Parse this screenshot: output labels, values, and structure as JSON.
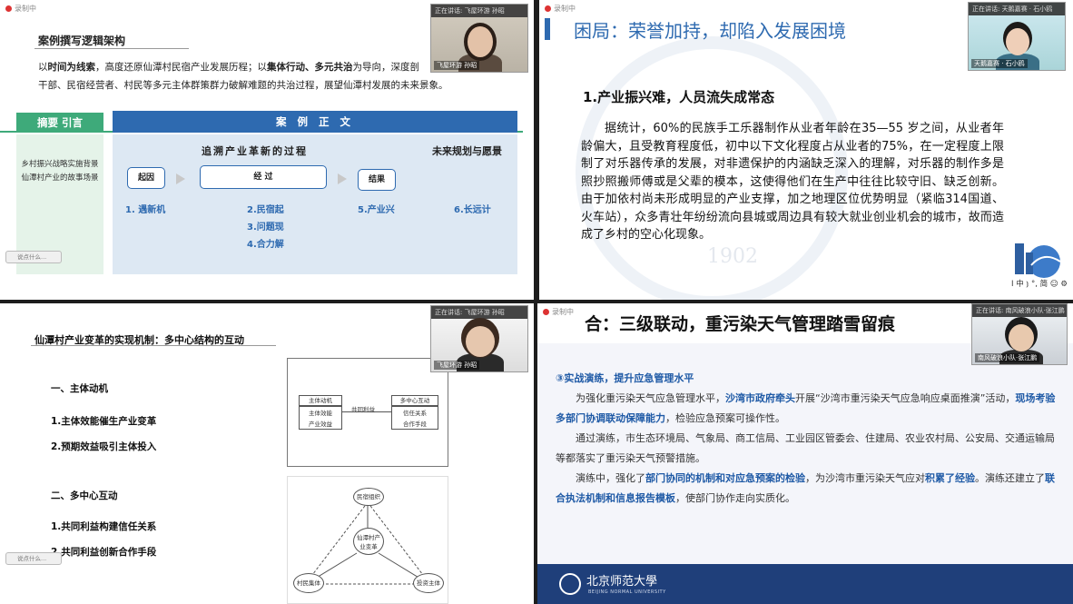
{
  "q1": {
    "recording": "录制中",
    "title": "案例撰写逻辑架构",
    "intro_line1_pre": "以",
    "intro_bold1": "时间为线索",
    "intro_mid1": "，高度还原仙潭村民宿产业发展历程；以",
    "intro_bold2": "集体行动、多元共治",
    "intro_mid2": "为导向，深度剖",
    "intro_line2": "干部、民宿经营者、村民等多元主体群策群力破解难题的共治过程，展望仙潭村发展的未来景象。",
    "abstract_header": "摘要 引言",
    "abstract_text1": "乡村振兴战略实施背景",
    "abstract_text2": "仙潭村产业的故事场景",
    "main_header": "案 例 正 文",
    "sub1": "追溯产业革新的过程",
    "sub2": "未来规划与愿景",
    "box_origin": "起因",
    "box_process": "经 过",
    "box_result": "结果",
    "steps": [
      "1. 遇新机",
      "2.民宿起",
      "3.问题现",
      "4.合力解",
      "5.产业兴",
      "6.长远计"
    ],
    "cam_speaking": "正在讲话: 飞屋环游  孙昭",
    "cam_name": "飞屋环游  孙昭",
    "chat_placeholder": "说点什么..."
  },
  "q2": {
    "title": "困局：荣誉加持，却陷入发展困境",
    "heading": "1.产业振兴难，人员流失成常态",
    "paragraph": "据统计，60%的民族手工乐器制作从业者年龄在35—55 岁之间，从业者年龄偏大，且受教育程度低，初中以下文化程度占从业者的75%，在一定程度上限制了对乐器传承的发展，对非遗保护的内涵缺乏深入的理解，对乐器的制作多是照抄照搬师傅或是父辈的模本，这使得他们在生产中往往比较守旧、缺乏创新。由于加依村尚未形成明显的产业支撑，加之地理区位优势明显（紧临314国道、火车站），众多青壮年纷纷流向县城或周边具有较大就业创业机会的城市，故而造成了乡村的空心化现象。",
    "watermark": "1902",
    "cam_speaking": "正在讲话: 天鹅嘉赛 · 石小鸥",
    "cam_name": "天鹅嘉赛 · 石小鸥",
    "ime": "I 中 ⦆ °, 简 ☺ ⚙"
  },
  "q3": {
    "title": "仙潭村产业变革的实现机制：多中心结构的互动",
    "sec1": "一、主体动机",
    "item1": "1.主体效能催生产业变革",
    "item2": "2.预期效益吸引主体投入",
    "sec2": "二、多中心互动",
    "item3": "1.共同利益构建信任关系",
    "item4": "2.共同利益创新合作手段",
    "d1_left_title": "主体动机",
    "d1_left_a": "主体效能",
    "d1_left_b": "产业效益",
    "d1_mid": "共同利益",
    "d1_right_title": "多中心互动",
    "d1_right_a": "信任关系",
    "d1_right_b": "合作手段",
    "d2_top": "民宿组织",
    "d2_center": "仙潭村产业变革",
    "d2_left": "村民集体",
    "d2_right": "投资主体",
    "cam_speaking": "正在讲话: 飞屋环游  孙昭",
    "cam_name": "飞屋环游  孙昭",
    "chat_placeholder": "说点什么..."
  },
  "q4": {
    "recording": "录制中",
    "title": "合：三级联动，重污染天气管理踏雪留痕",
    "subtitle": "③实战演练，提升应急管理水平",
    "p1_a": "为强化重污染天气应急管理水平，",
    "p1_b": "沙湾市政府牵头",
    "p1_c": "开展“沙湾市重污染天气应急响应桌面推演”活动，",
    "p1_d": "现场考验多部门协调联动保障能力",
    "p1_e": "，检验应急预案可操作性。",
    "p2": "通过演练，市生态环境局、气象局、商工信局、工业园区管委会、住建局、农业农村局、公安局、交通运输局等都落实了重污染天气预警措施。",
    "p3_a": "演练中，强化了",
    "p3_b": "部门协同的机制和对应急预案的检验",
    "p3_c": "，为沙湾市重污染天气应对",
    "p3_d": "积累了经验",
    "p3_e": "。演练还建立了",
    "p3_f": "联合执法机制和信息报告模板",
    "p3_g": "，使部门协作走向实质化。",
    "footer_cn": "北京师范大學",
    "footer_en": "BEIJING NORMAL UNIVERSITY",
    "cam_speaking": "正在讲话: 南风破浪小队·张江鹏",
    "cam_name": "南风破浪小队·张江鹏"
  },
  "colors": {
    "blue": "#2e6ab0",
    "green": "#3eaa7a",
    "navy": "#1f3f7a"
  }
}
